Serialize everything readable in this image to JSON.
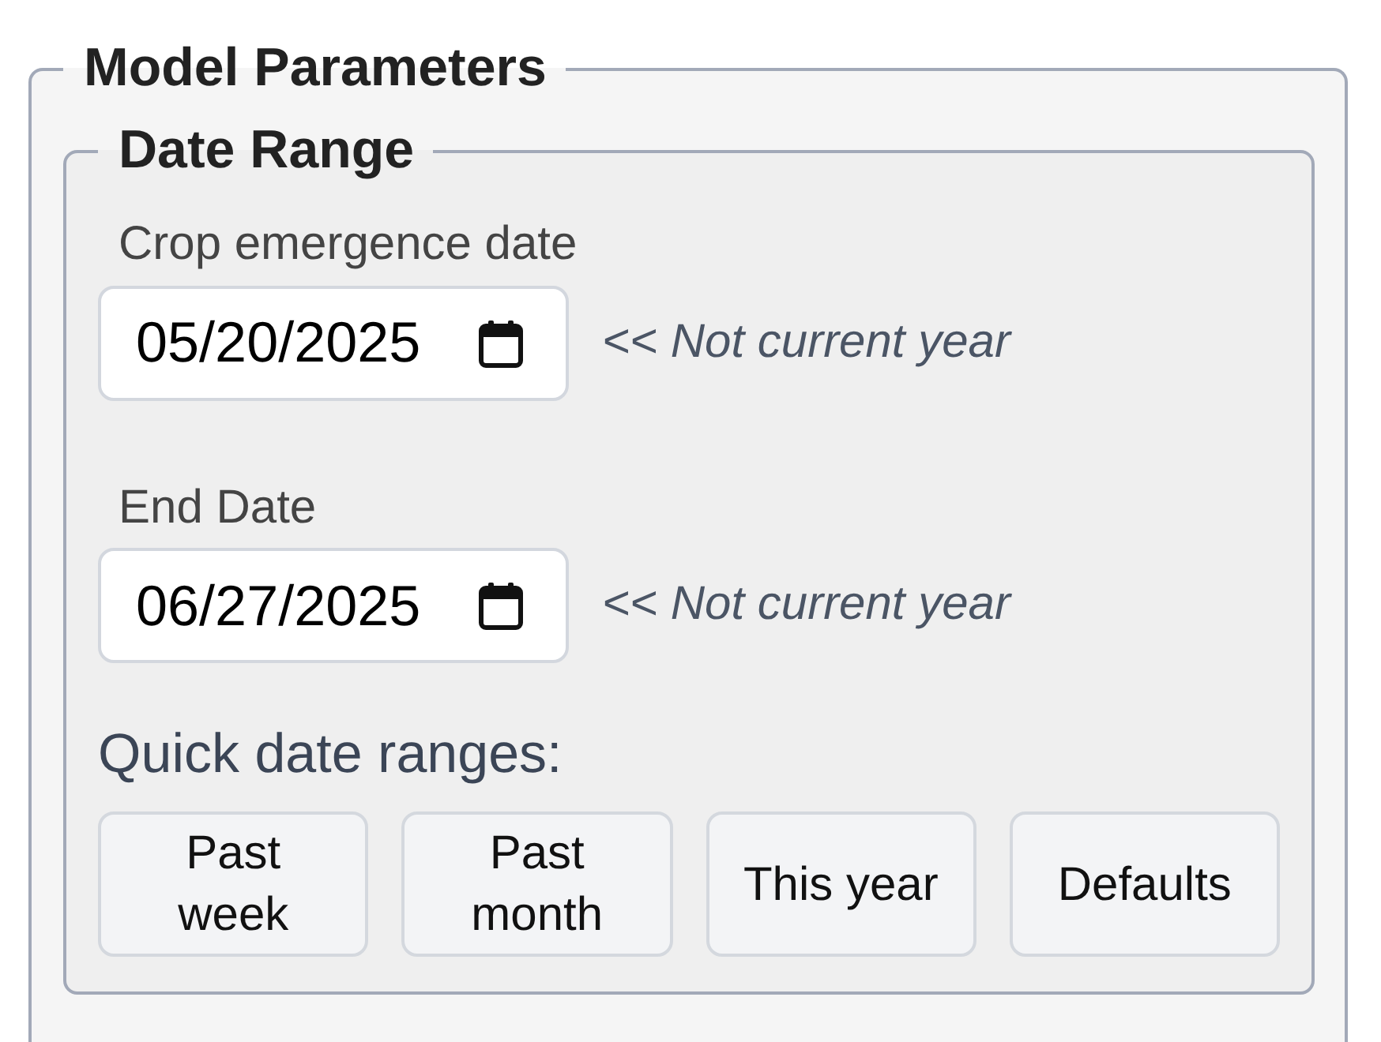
{
  "panel": {
    "legend": "Model Parameters",
    "sections": [
      {
        "legend": "Date Range",
        "date_fields": [
          {
            "label": "Crop emergence date",
            "value": "05/20/2025",
            "note": "<< Not current year"
          },
          {
            "label": "End Date",
            "value": "06/27/2025",
            "note": "<< Not current year"
          }
        ],
        "quick_ranges": {
          "label": "Quick date ranges:",
          "buttons": [
            "Past week",
            "Past month",
            "This year",
            "Defaults"
          ]
        }
      }
    ]
  }
}
